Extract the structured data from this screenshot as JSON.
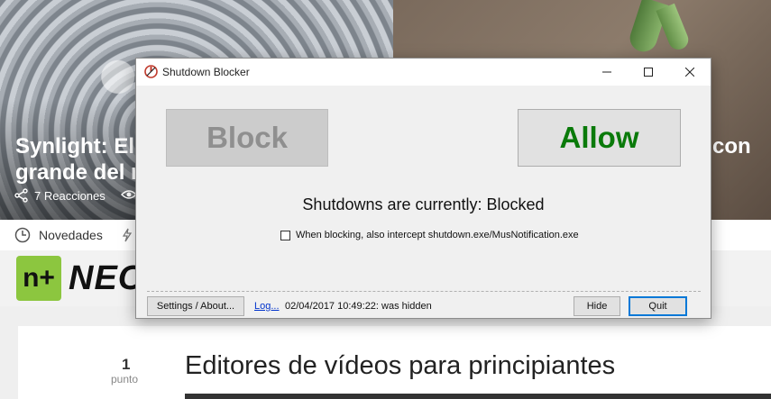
{
  "background_page": {
    "hero_left_title": "Synlight: El\ngrande del m",
    "hero_right_title": "con",
    "reactions": "7 Reacciones",
    "nav_item": "Novedades",
    "logo_badge": "n+",
    "logo_text": "NEO",
    "vote_count": "1",
    "vote_unit": "punto",
    "article_title": "Editores de vídeos para principiantes"
  },
  "window": {
    "title": "Shutdown Blocker",
    "block_label": "Block",
    "allow_label": "Allow",
    "status_text": "Shutdowns are currently: Blocked",
    "option_label": "When blocking, also intercept shutdown.exe/MusNotification.exe",
    "option_checked": false,
    "settings_label": "Settings / About...",
    "log_label": "Log...",
    "log_message": "02/04/2017 10:49:22: was hidden",
    "hide_label": "Hide",
    "quit_label": "Quit"
  },
  "icons": [
    "share-icon",
    "eye-icon",
    "clock-icon",
    "bolt-icon",
    "shutdown-app-icon",
    "minimize-icon",
    "maximize-icon",
    "close-icon"
  ],
  "colors": {
    "allow_text": "#0a7a0a",
    "block_text": "#8f8f8f",
    "link": "#0033cc",
    "focus_border": "#0078d7",
    "logo_green": "#8cc63f"
  }
}
